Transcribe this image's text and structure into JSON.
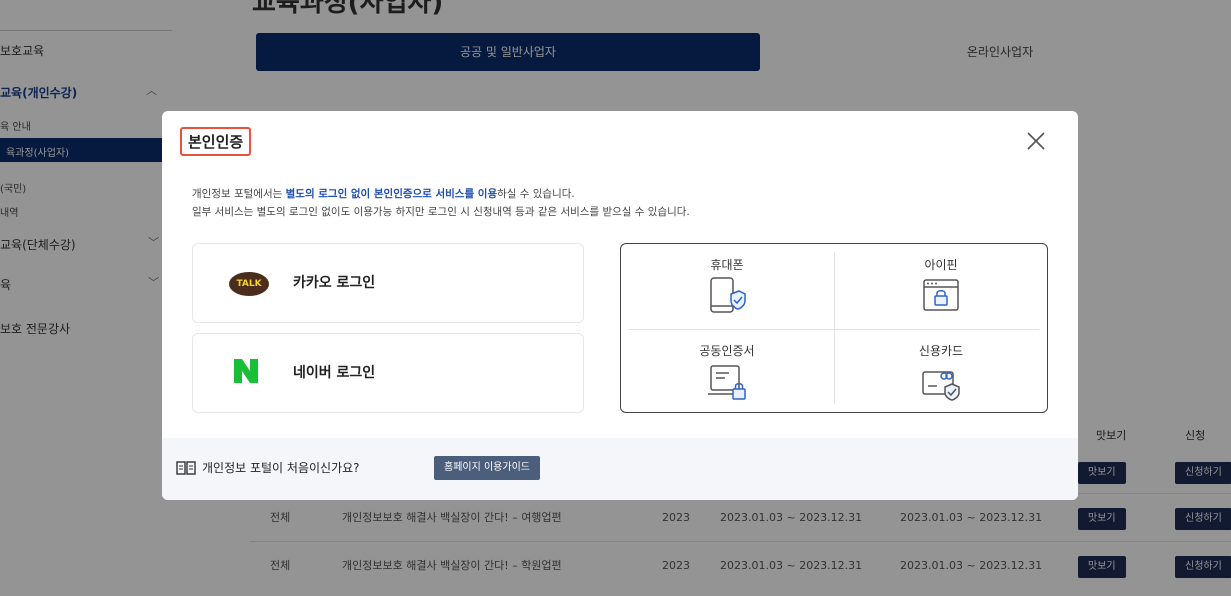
{
  "background": {
    "page_title": "교육과정(사업자)",
    "sidebar": {
      "items": [
        {
          "label": "보호교육"
        },
        {
          "label": "교육(개인수강)"
        },
        {
          "label": "육 안내"
        },
        {
          "label": "육과정(사업자)"
        },
        {
          "label": "(국민)"
        },
        {
          "label": "내역"
        },
        {
          "label": "교육(단체수강)"
        },
        {
          "label": "육"
        },
        {
          "label": "보호 전문강사"
        }
      ]
    },
    "tabs": [
      {
        "label": "공공 및 일반사업자"
      },
      {
        "label": "온라인사업자"
      }
    ],
    "table": {
      "headers": {
        "preview": "맛보기",
        "apply": "신청"
      },
      "rows": [
        {
          "category": "전체",
          "title": "개인정보보호 해결사 백실장이 간다! – 여행업편",
          "year": "2023",
          "period1": "2023.01.03 ~ 2023.12.31",
          "period2": "2023.01.03 ~ 2023.12.31",
          "preview_btn": "맛보기",
          "apply_btn": "신청하기"
        },
        {
          "category": "전체",
          "title": "개인정보보호 해결사 백실장이 간다! – 학원업편",
          "year": "2023",
          "period1": "2023.01.03 ~ 2023.12.31",
          "period2": "2023.01.03 ~ 2023.12.31",
          "preview_btn": "맛보기",
          "apply_btn": "신청하기"
        }
      ],
      "hidden_row_buttons": {
        "preview_btn": "맛보기",
        "apply_btn": "신청하기"
      }
    }
  },
  "modal": {
    "title": "본인인증",
    "description": {
      "line1_pre": "개인정보 포털에서는 ",
      "line1_highlight": "별도의 로그인 없이 본인인증으로 서비스를 이용",
      "line1_post": "하실 수 있습니다.",
      "line2": "일부 서비스는 별도의 로그인 없이도 이용가능 하지만 로그인 시 신청내역 등과 같은 서비스를 받으실 수 있습니다."
    },
    "social_logins": {
      "kakao": {
        "label": "카카오 로그인",
        "logo_text": "TALK"
      },
      "naver": {
        "label": "네이버 로그인"
      }
    },
    "auth_methods": [
      {
        "label": "휴대폰",
        "icon": "phone-shield-icon"
      },
      {
        "label": "아이핀",
        "icon": "browser-lock-icon"
      },
      {
        "label": "공동인증서",
        "icon": "certificate-lock-icon"
      },
      {
        "label": "신용카드",
        "icon": "card-shield-icon"
      }
    ],
    "footer": {
      "question": "개인정보 포털이 처음이신가요?",
      "guide_button": "홈페이지 이용가이드"
    }
  }
}
